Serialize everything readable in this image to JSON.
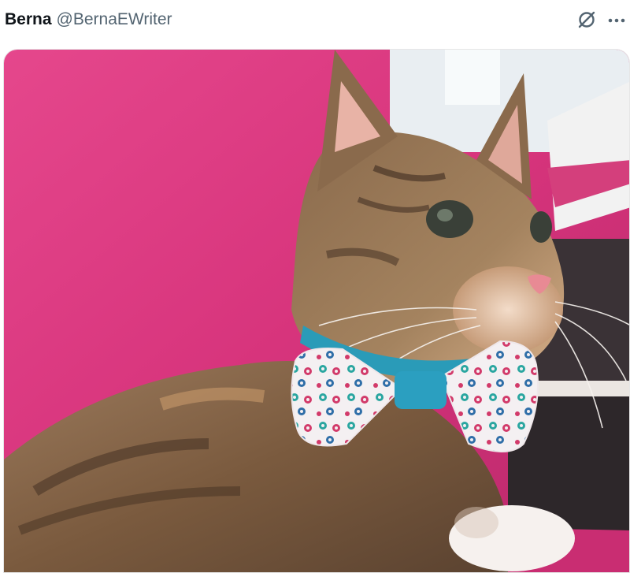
{
  "tweet": {
    "author": {
      "display_name": "Berna",
      "handle": "@BernaEWriter"
    },
    "icons": {
      "grok": "grok-icon",
      "more": "more-icon"
    },
    "colors": {
      "text": "#0f1419",
      "secondary_text": "#536471"
    },
    "media": {
      "kind": "photo",
      "icon": "cat-photo"
    }
  }
}
